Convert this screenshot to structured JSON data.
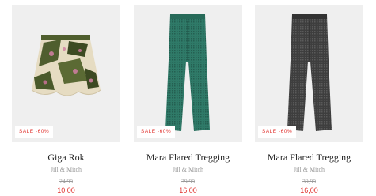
{
  "products": [
    {
      "title": "Giga Rok",
      "brand": "Jill & Mitch",
      "badge": "SALE -60%",
      "old_price": "24,99",
      "new_price": "10,00",
      "image": "patterned-mini-skirt"
    },
    {
      "title": "Mara Flared Tregging",
      "brand": "Jill & Mitch",
      "badge": "SALE -60%",
      "old_price": "39,99",
      "new_price": "16,00",
      "image": "green-flared-trousers"
    },
    {
      "title": "Mara Flared Tregging",
      "brand": "Jill & Mitch",
      "badge": "SALE -60%",
      "old_price": "39,99",
      "new_price": "16,00",
      "image": "grey-flared-trousers"
    }
  ],
  "colors": {
    "sale_red": "#e0322e",
    "muted_text": "#9a9a9a",
    "image_bg": "#efefef",
    "trouser_green": "#2f7a68",
    "trouser_grey": "#3e3e3e",
    "skirt_cream": "#e6dcc2",
    "skirt_green": "#4f5e2e",
    "skirt_pink": "#c07b93"
  }
}
